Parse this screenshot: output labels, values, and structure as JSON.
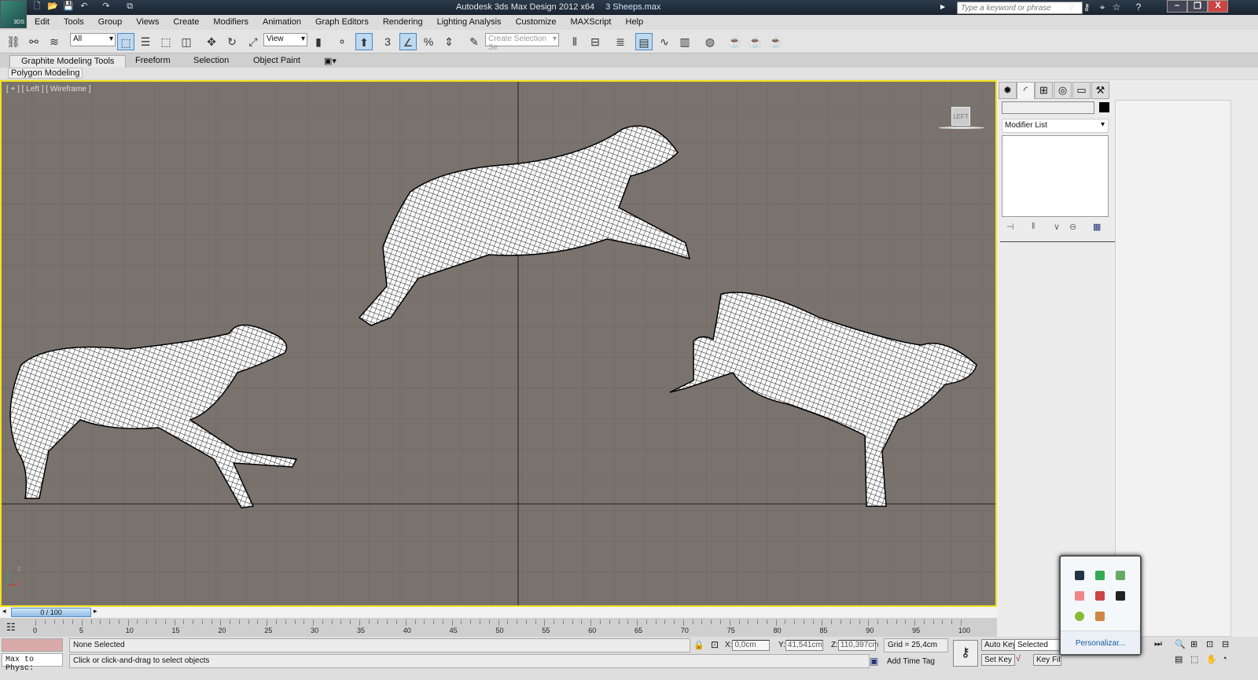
{
  "window": {
    "app_title": "Autodesk 3ds Max Design 2012 x64",
    "file_name": "3 Sheeps.max",
    "logo_text": "3DS"
  },
  "search": {
    "placeholder": "Type a keyword or phrase"
  },
  "menu": [
    "Edit",
    "Tools",
    "Group",
    "Views",
    "Create",
    "Modifiers",
    "Animation",
    "Graph Editors",
    "Rendering",
    "Lighting Analysis",
    "Customize",
    "MAXScript",
    "Help"
  ],
  "toolbar": {
    "selection_filter": "All",
    "reference_coord": "View",
    "named_selection_placeholder": "Create Selection Se",
    "snap_label": "3"
  },
  "ribbon": {
    "tabs": [
      "Graphite Modeling Tools",
      "Freeform",
      "Selection",
      "Object Paint"
    ],
    "active_tab": "Graphite Modeling Tools",
    "panel": "Polygon Modeling"
  },
  "viewport": {
    "label": "[ + ] [ Left ] [ Wireframe ]",
    "viewcube": "LEFT",
    "axis_z": "z",
    "axis_y": "y"
  },
  "command_panel": {
    "modifier_list": "Modifier List"
  },
  "time_slider": {
    "value": "0 / 100",
    "current": 0,
    "max": 100
  },
  "track_labels": [
    "0",
    "5",
    "10",
    "15",
    "20",
    "25",
    "30",
    "35",
    "40",
    "45",
    "50",
    "55",
    "60",
    "65",
    "70",
    "75",
    "80",
    "85",
    "90",
    "95",
    "100"
  ],
  "status": {
    "selection": "None Selected",
    "prompt": "Click or click-and-drag to select objects",
    "maxscript": "Max to Physc:",
    "x_label": "X:",
    "x": "0,0cm",
    "y_label": "Y:",
    "y": "41,541cm",
    "z_label": "Z:",
    "z": "110,397cm",
    "grid": "Grid = 25,4cm",
    "add_time_tag": "Add Time Tag",
    "auto_key": "Auto Key",
    "set_key": "Set Key",
    "key_mode": "Selected",
    "key_filters": "Key Filters..."
  },
  "tray": {
    "customize": "Personalizar..."
  },
  "colors": {
    "viewport_bg": "#7a736d",
    "viewport_border": "#f2e21a",
    "accent": "#4a8ac0"
  }
}
